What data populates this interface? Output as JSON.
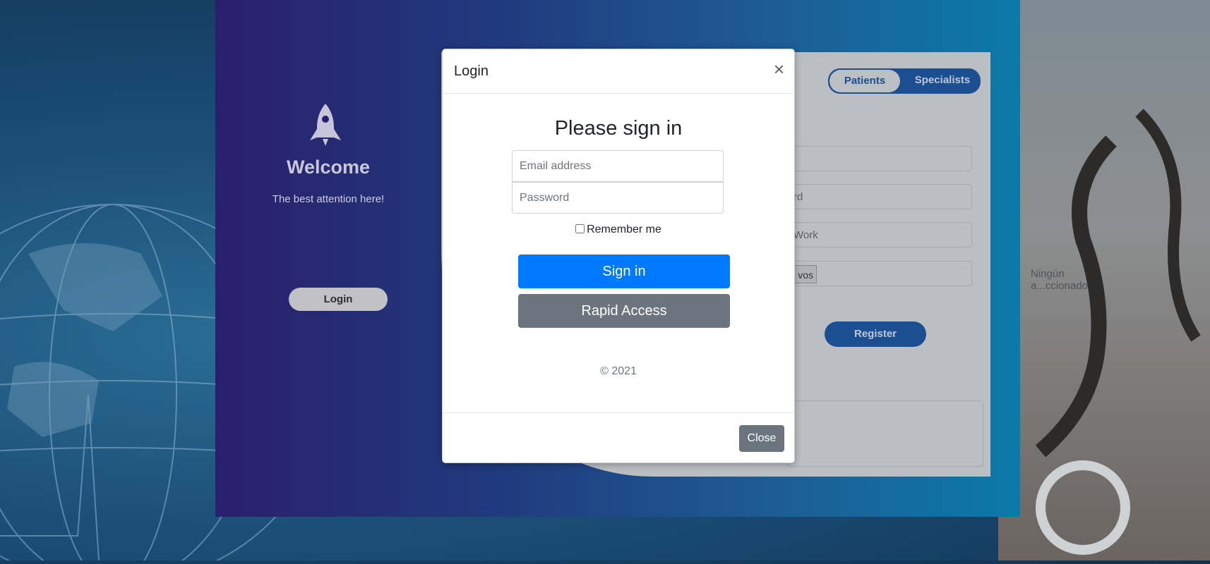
{
  "background": {
    "left_panel": {
      "icon": "rocket-icon",
      "welcome": "Welcome",
      "tagline": "The best attention here!",
      "login_button": "Login"
    },
    "right_panel": {
      "toggle": {
        "active": "Patients",
        "inactive": "Specialists"
      },
      "field_password_partial": "rd",
      "field_work_partial": "Work",
      "file_button_partial": "vos",
      "file_status": "Ningún a...ccionado",
      "register_button": "Register"
    }
  },
  "modal": {
    "title": "Login",
    "close_icon": "close-icon",
    "heading": "Please sign in",
    "email_placeholder": "Email address",
    "password_placeholder": "Password",
    "remember_label": "Remember me",
    "sign_in_button": "Sign in",
    "rapid_access_button": "Rapid Access",
    "copyright": "© 2021",
    "close_button": "Close"
  },
  "colors": {
    "primary": "#007bff",
    "secondary": "#6c757d",
    "card_gradient_start": "#2a1f6e",
    "card_gradient_end": "#0b7aa9",
    "accent_dark": "#1c4f91"
  }
}
